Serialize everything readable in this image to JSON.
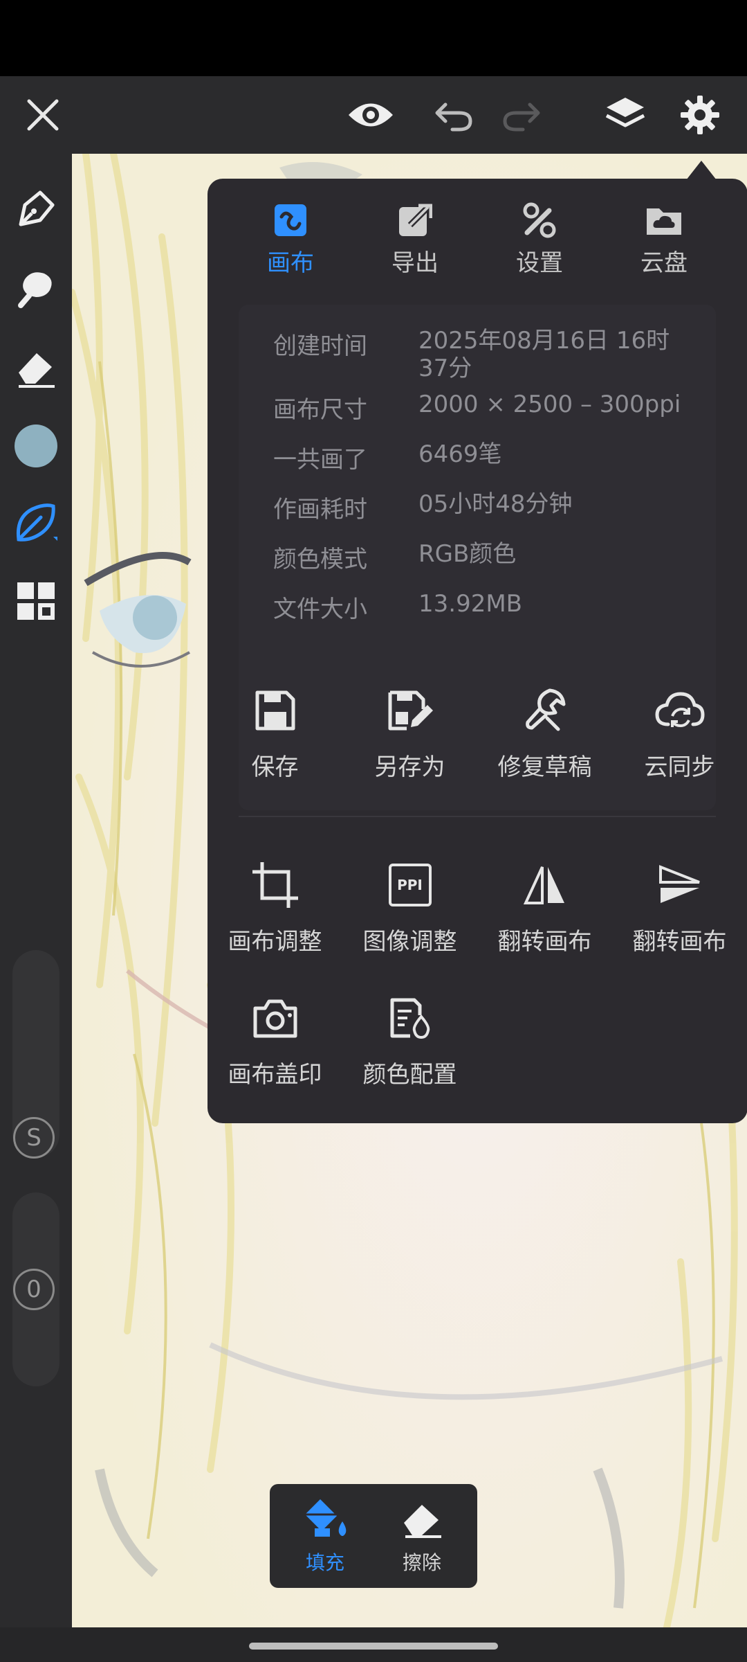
{
  "colors": {
    "accent": "#2f90ff",
    "panel": "#2c2a2f",
    "toolbar": "#2b2b2d",
    "brush_color": "#8eb1c0"
  },
  "topbar": {
    "close_icon": "close-icon",
    "icons": [
      "eye-icon",
      "undo-icon",
      "redo-icon",
      "layers-icon",
      "gear-icon"
    ]
  },
  "sidebar": {
    "tools": [
      "pen-icon",
      "smudge-icon",
      "eraser-icon",
      "color-swatch",
      "leaf-brush-icon",
      "grid-icon"
    ],
    "size_label": "S",
    "opacity_label": "0"
  },
  "panel": {
    "tabs": [
      {
        "label": "画布",
        "icon": "canvas-icon",
        "active": true
      },
      {
        "label": "导出",
        "icon": "export-icon",
        "active": false
      },
      {
        "label": "设置",
        "icon": "tools-icon",
        "active": false
      },
      {
        "label": "云盘",
        "icon": "cloud-folder-icon",
        "active": false
      }
    ],
    "info": [
      {
        "key": "创建时间",
        "value": "2025年08月16日 16时37分"
      },
      {
        "key": "画布尺寸",
        "value": "2000 × 2500 – 300ppi"
      },
      {
        "key": "一共画了",
        "value": "6469笔"
      },
      {
        "key": "作画耗时",
        "value": "05小时48分钟"
      },
      {
        "key": "颜色模式",
        "value": "RGB颜色"
      },
      {
        "key": "文件大小",
        "value": "13.92MB"
      }
    ],
    "file_actions": [
      {
        "label": "保存",
        "icon": "save-icon"
      },
      {
        "label": "另存为",
        "icon": "save-as-icon"
      },
      {
        "label": "修复草稿",
        "icon": "wrench-icon"
      },
      {
        "label": "云同步",
        "icon": "cloud-sync-icon"
      }
    ],
    "canvas_actions": [
      {
        "label": "画布调整",
        "icon": "crop-icon"
      },
      {
        "label": "图像调整",
        "icon": "ppi-icon",
        "icon_text": "PPI"
      },
      {
        "label": "翻转画布",
        "icon": "flip-horizontal-icon"
      },
      {
        "label": "翻转画布",
        "icon": "flip-vertical-icon"
      },
      {
        "label": "画布盖印",
        "icon": "camera-icon"
      },
      {
        "label": "颜色配置",
        "icon": "color-profile-icon"
      }
    ]
  },
  "fill_tools": {
    "fill_label": "填充",
    "erase_label": "擦除"
  }
}
